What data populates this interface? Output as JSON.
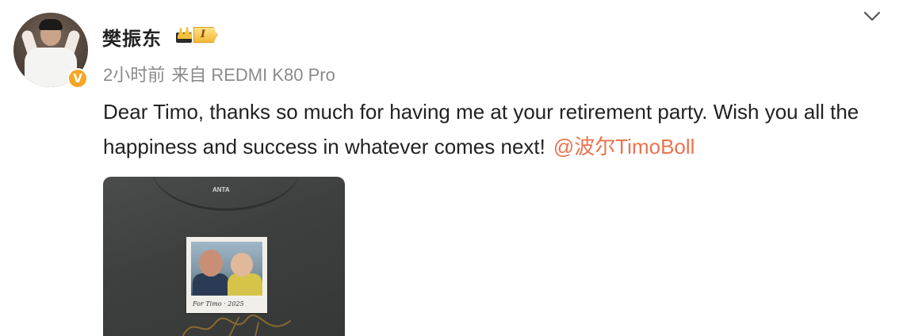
{
  "post": {
    "author": {
      "name": "樊振东",
      "level_badge": "I"
    },
    "meta": {
      "time": "2小时前",
      "source": "来自 REDMI K80 Pro"
    },
    "content": {
      "text": "Dear Timo, thanks so much for having me at your retirement party. Wish you all the happiness and success in whatever comes next!",
      "mention": "@波尔TimoBoll"
    },
    "image": {
      "icon": "photo-of-tshirt-with-polaroid"
    }
  },
  "icons": {
    "menu": "chevron-down-icon",
    "verified": "verified-icon",
    "crown": "crown-icon"
  },
  "colors": {
    "text": "#222222",
    "meta": "#8a8a8a",
    "mention": "#eb7350",
    "verified": "#f5a623",
    "badge": "#f3b93a"
  }
}
